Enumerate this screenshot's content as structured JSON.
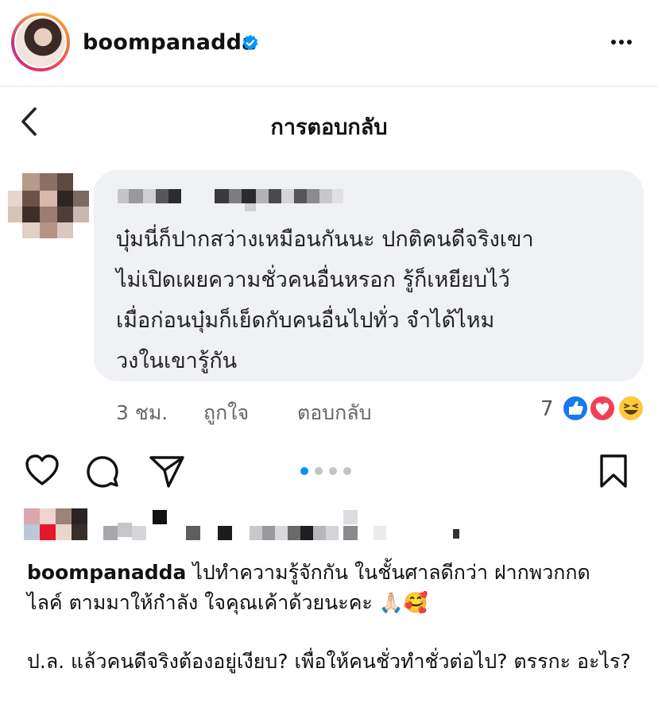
{
  "header": {
    "username": "boompanadda"
  },
  "screenshot": {
    "title": "การตอบกลับ",
    "comment_lines": [
      "บุ๋มนี่ก็ปากสว่างเหมือนกันนะ ปกติคนดีจริงเขา",
      "ไม่เปิดเผยความชั่วคนอื่นหรอก รู้ก็เหยียบไว้",
      "เมื่อก่อนบุ๋มก็เย็ดกับคนอื่นไปทั่ว จำได้ไหม",
      "วงในเขารู้กัน"
    ],
    "time": "3 ชม.",
    "like_label": "ถูกใจ",
    "reply_label": "ตอบกลับ",
    "reaction_count": "7"
  },
  "post": {
    "carousel_total": 4,
    "carousel_active": 1
  },
  "caption": {
    "username": "boompanadda",
    "text": " ไปทำความรู้จักกัน ในชั้นศาลดีกว่า ฝากพวกกด ไลค์ ตามมาให้กำลัง ใจคุณเค้าด้วยนะคะ 🙏🏻🥰",
    "paragraph2": "ป.ล. แล้วคนดีจริงต้องอยู่เงียบ? เพื่อให้คนชั่วทำชั่วต่อไป? ตรรกะ อะไร?"
  },
  "colors": {
    "accent_blue": "#1877f2",
    "verified_blue": "#0095f6",
    "bubble_bg": "#f0f1f4"
  }
}
